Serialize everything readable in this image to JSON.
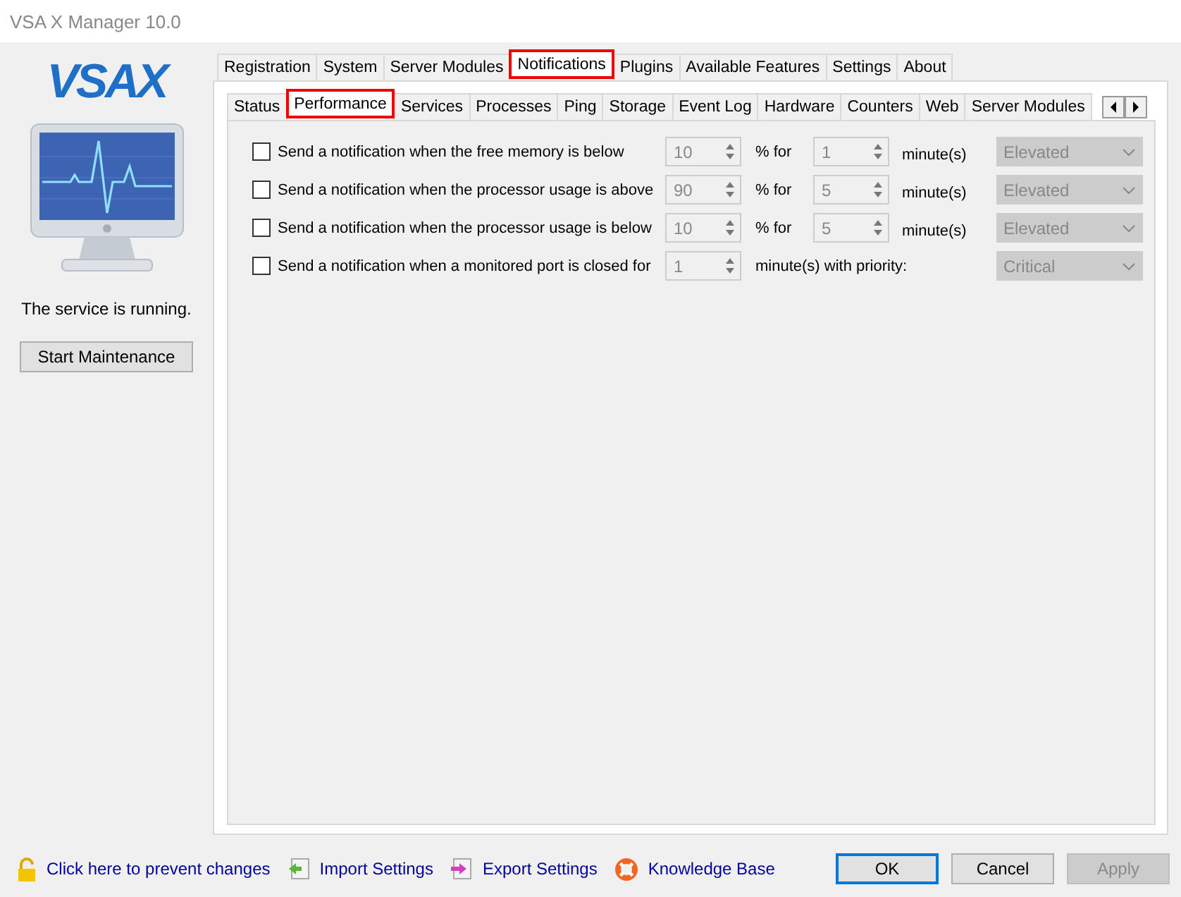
{
  "window": {
    "title": "VSA X Manager 10.0"
  },
  "sidebar": {
    "logo": "VSAX",
    "status": "The service is running.",
    "button": "Start Maintenance"
  },
  "tabs": [
    {
      "label": "Registration",
      "selected": false
    },
    {
      "label": "System",
      "selected": false
    },
    {
      "label": "Server Modules",
      "selected": false
    },
    {
      "label": "Notifications",
      "selected": true
    },
    {
      "label": "Plugins",
      "selected": false
    },
    {
      "label": "Available Features",
      "selected": false
    },
    {
      "label": "Settings",
      "selected": false
    },
    {
      "label": "About",
      "selected": false
    }
  ],
  "subtabs": [
    {
      "label": "Status",
      "selected": false
    },
    {
      "label": "Performance",
      "selected": true
    },
    {
      "label": "Services",
      "selected": false
    },
    {
      "label": "Processes",
      "selected": false
    },
    {
      "label": "Ping",
      "selected": false
    },
    {
      "label": "Storage",
      "selected": false
    },
    {
      "label": "Event Log",
      "selected": false
    },
    {
      "label": "Hardware",
      "selected": false
    },
    {
      "label": "Counters",
      "selected": false
    },
    {
      "label": "Web",
      "selected": false
    },
    {
      "label": "Server Modules",
      "selected": false
    }
  ],
  "rows": [
    {
      "kind": "threshold",
      "checked": false,
      "disabled": true,
      "label": "Send a notification when the free memory is below",
      "value": "10",
      "between": "% for",
      "duration": "1",
      "unit": "minute(s)",
      "priority": "Elevated"
    },
    {
      "kind": "threshold",
      "checked": false,
      "disabled": true,
      "label": "Send a notification when the processor usage is above",
      "value": "90",
      "between": "% for",
      "duration": "5",
      "unit": "minute(s)",
      "priority": "Elevated"
    },
    {
      "kind": "threshold",
      "checked": false,
      "disabled": true,
      "label": "Send a notification when the processor usage is below",
      "value": "10",
      "between": "% for",
      "duration": "5",
      "unit": "minute(s)",
      "priority": "Elevated"
    },
    {
      "kind": "port",
      "checked": false,
      "disabled": true,
      "label": "Send a notification when a monitored port is closed for",
      "value": "1",
      "between": "minute(s) with priority:",
      "priority": "Critical"
    }
  ],
  "footer_links": [
    {
      "kind": "lock",
      "label": "Click here to prevent changes"
    },
    {
      "kind": "import",
      "label": "Import Settings"
    },
    {
      "kind": "export",
      "label": "Export Settings"
    },
    {
      "kind": "help",
      "label": "Knowledge Base"
    }
  ],
  "buttons": [
    {
      "label": "OK",
      "default": true,
      "disabled": false
    },
    {
      "label": "Cancel",
      "default": false,
      "disabled": false
    },
    {
      "label": "Apply",
      "default": false,
      "disabled": true
    }
  ]
}
